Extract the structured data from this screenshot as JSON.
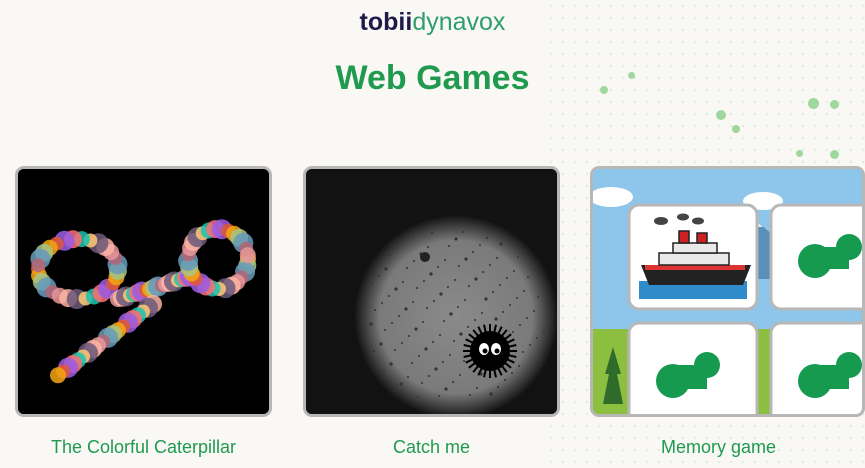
{
  "brand": {
    "part1": "tobii",
    "part2": "dynavox"
  },
  "page": {
    "title": "Web Games"
  },
  "games": [
    {
      "label": "The Colorful Caterpillar",
      "thumbnail": "caterpillar-thumbnail"
    },
    {
      "label": "Catch me",
      "thumbnail": "spotlight-thumbnail"
    },
    {
      "label": "Memory game",
      "thumbnail": "memory-cards-thumbnail"
    }
  ],
  "colors": {
    "accent": "#1f9a4f",
    "brand_dark": "#1e1b4b",
    "card_border": "#b7b7b7"
  }
}
